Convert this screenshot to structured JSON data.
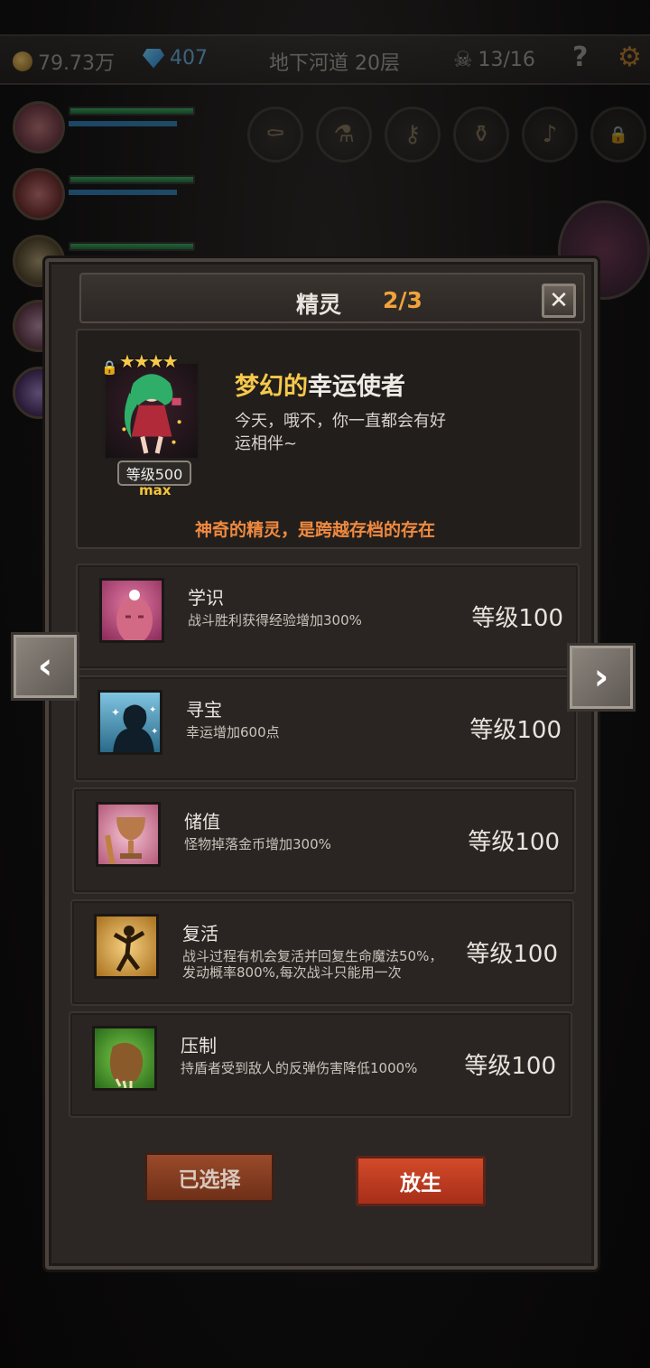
{
  "topbar": {
    "gold": "79.73万",
    "gems": "407",
    "location": "地下河道 20层",
    "kills": "13/16",
    "help": "?"
  },
  "dialog": {
    "title": "精灵",
    "count": "2/3",
    "close": "✕"
  },
  "spirit": {
    "stars": "★★★★",
    "lock": "🔒",
    "name_highlight": "梦幻的",
    "name_rest": "幸运使者",
    "description": "今天，哦不，你一直都会有好运相伴~",
    "level_badge": "等级500",
    "max_label": "max",
    "tagline": "神奇的精灵，是跨越存档的存在"
  },
  "skills": [
    {
      "name": "学识",
      "desc": "战斗胜利获得经验增加300%",
      "level": "等级100",
      "icon": "knowledge-icon"
    },
    {
      "name": "寻宝",
      "desc": "幸运增加600点",
      "level": "等级100",
      "icon": "treasure-icon"
    },
    {
      "name": "储值",
      "desc": "怪物掉落金币增加300%",
      "level": "等级100",
      "icon": "savings-icon"
    },
    {
      "name": "复活",
      "desc": "战斗过程有机会复活并回复生命魔法50%，发动概率800%,每次战斗只能用一次",
      "level": "等级100",
      "icon": "revive-icon"
    },
    {
      "name": "压制",
      "desc": "持盾者受到敌人的反弹伤害降低1000%",
      "level": "等级100",
      "icon": "suppress-icon"
    }
  ],
  "buttons": {
    "selected": "已选择",
    "release": "放生",
    "prev": "‹",
    "next": "›"
  },
  "colors": {
    "accent_gold": "#f6c94a",
    "accent_orange": "#f2a23b",
    "tagline": "#f08a40",
    "release_button": "#c23a1f"
  }
}
